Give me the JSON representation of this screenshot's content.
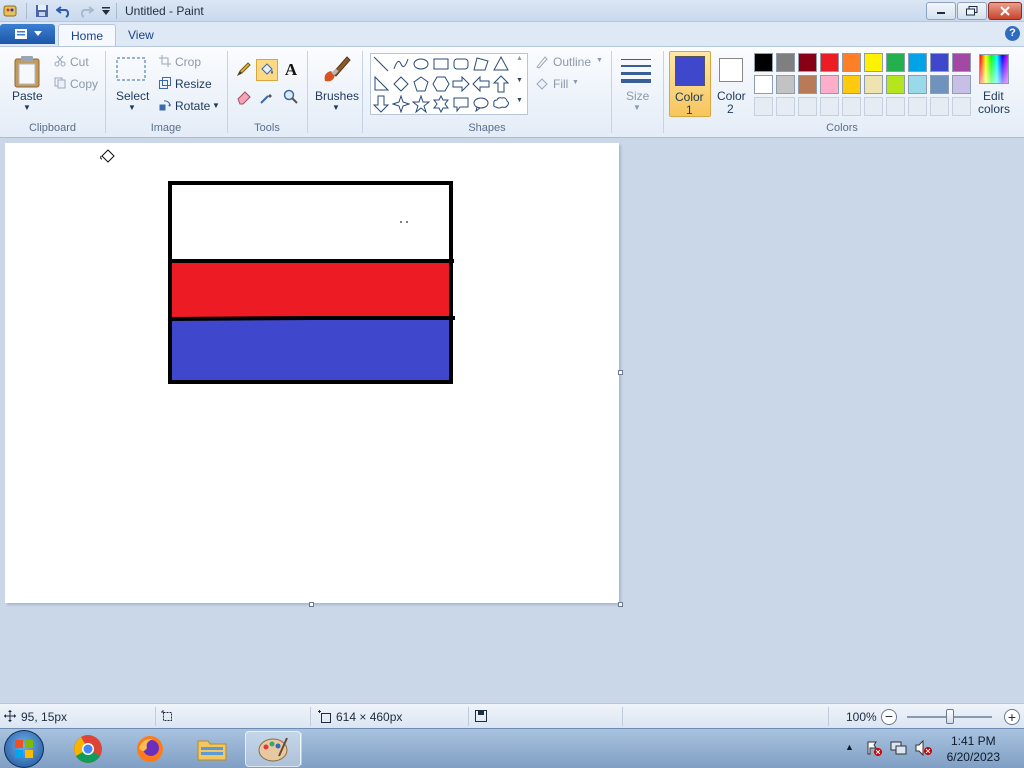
{
  "window": {
    "title": "Untitled - Paint"
  },
  "tabs": [
    {
      "label": "Home"
    },
    {
      "label": "View"
    }
  ],
  "ribbon": {
    "clipboard": {
      "paste": "Paste",
      "cut": "Cut",
      "copy": "Copy",
      "group": "Clipboard"
    },
    "image": {
      "select": "Select",
      "crop": "Crop",
      "resize": "Resize",
      "rotate": "Rotate",
      "group": "Image"
    },
    "tools": {
      "group": "Tools"
    },
    "brushes": {
      "label": "Brushes"
    },
    "shapes": {
      "outline": "Outline",
      "fill": "Fill",
      "group": "Shapes"
    },
    "size": {
      "label": "Size"
    },
    "colors": {
      "color1": "Color",
      "color1_num": "1",
      "color2": "Color",
      "color2_num": "2",
      "edit1": "Edit",
      "edit2": "colors",
      "group": "Colors",
      "color1_value": "#3f48cc",
      "color2_value": "#ffffff",
      "palette_row1": [
        "#000000",
        "#7f7f7f",
        "#880015",
        "#ed1c24",
        "#ff7f27",
        "#fff200",
        "#22b14c",
        "#00a2e8",
        "#3f48cc",
        "#a349a4"
      ],
      "palette_row2": [
        "#ffffff",
        "#c3c3c3",
        "#b97a57",
        "#ffaec9",
        "#ffc90e",
        "#efe4b0",
        "#b5e61d",
        "#99d9ea",
        "#7092be",
        "#c8bfe7"
      ]
    }
  },
  "drawing": {
    "stripe_top": "#ffffff",
    "stripe_middle": "#ed1c24",
    "stripe_bottom": "#3f48cc",
    "outline": "#000000"
  },
  "status": {
    "cursor_pos": "95, 15px",
    "image_size": "614 × 460px",
    "zoom": "100%",
    "zoom_level": 0.5
  },
  "taskbar": {
    "time": "1:41 PM",
    "date": "6/20/2023"
  }
}
